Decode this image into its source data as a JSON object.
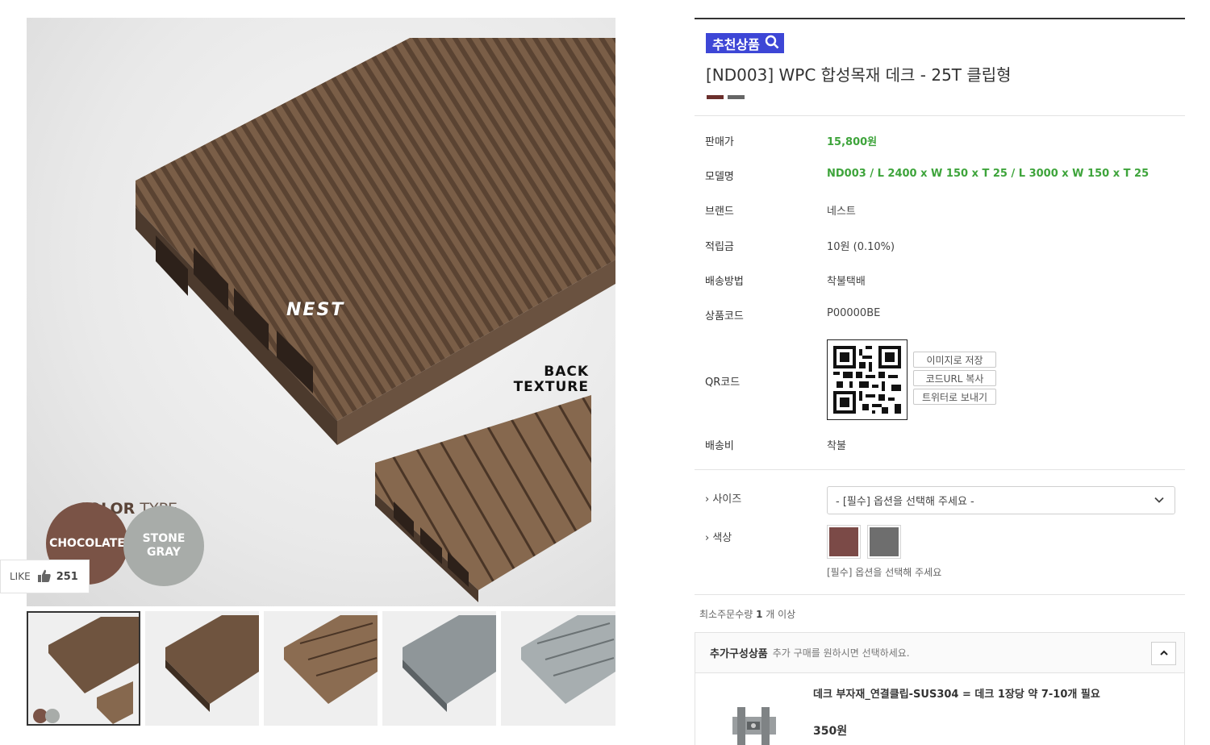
{
  "gallery": {
    "main_image_logo": "NEST",
    "back_texture_line1": "BACK",
    "back_texture_line2": "TEXTURE",
    "color_type_bold": "COLOR",
    "color_type_light": " TYPE",
    "swatch_chocolate": "CHOCOLATE",
    "swatch_stone_line1": "STONE",
    "swatch_stone_line2": "GRAY",
    "thumbnails": [
      "chocolate-front-and-back",
      "chocolate-front",
      "chocolate-back",
      "stone-gray-front",
      "stone-gray-back"
    ]
  },
  "like": {
    "label": "LIKE",
    "count": "251"
  },
  "product": {
    "badge": "추천상품",
    "title": "[ND003] WPC 합성목재 데크 - 25T 클립형",
    "color_chips": [
      "#6b2f2c",
      "#666666"
    ]
  },
  "specs": [
    {
      "label": "판매가",
      "value": "15,800원"
    },
    {
      "label": "모델명",
      "value": "ND003 / L 2400 x W 150 x T 25 / L 3000 x W 150 x T 25"
    },
    {
      "label": "브랜드",
      "value": "네스트"
    },
    {
      "label": "적립금",
      "value": "10원 (0.10%)"
    },
    {
      "label": "배송방법",
      "value": "착불택배"
    },
    {
      "label": "상품코드",
      "value": "P00000BE"
    },
    {
      "label": "QR코드",
      "value": ""
    },
    {
      "label": "배송비",
      "value": "착불"
    }
  ],
  "qr_buttons": [
    "이미지로 저장",
    "코드URL 복사",
    "트위터로 보내기"
  ],
  "options": {
    "size_label": "› 사이즈",
    "size_placeholder": "- [필수] 옵션을 선택해 주세요 -",
    "color_label": "› 색상",
    "color_swatches": [
      "#7b4a47",
      "#6e6e6e"
    ],
    "color_hint": "[필수] 옵션을 선택해 주세요"
  },
  "min_order": {
    "prefix": "최소주문수량 ",
    "qty": "1",
    "suffix": " 개 이상"
  },
  "addon": {
    "title": "추가구성상품",
    "subtitle": "추가 구매를 원하시면 선택하세요.",
    "item_name": "데크 부자재_연결클립-SUS304 = 데크 1장당 약 7-10개 필요",
    "item_price": "350원"
  },
  "colors": {
    "accent_badge": "#3d46d6",
    "price_green": "#3ea43b"
  }
}
